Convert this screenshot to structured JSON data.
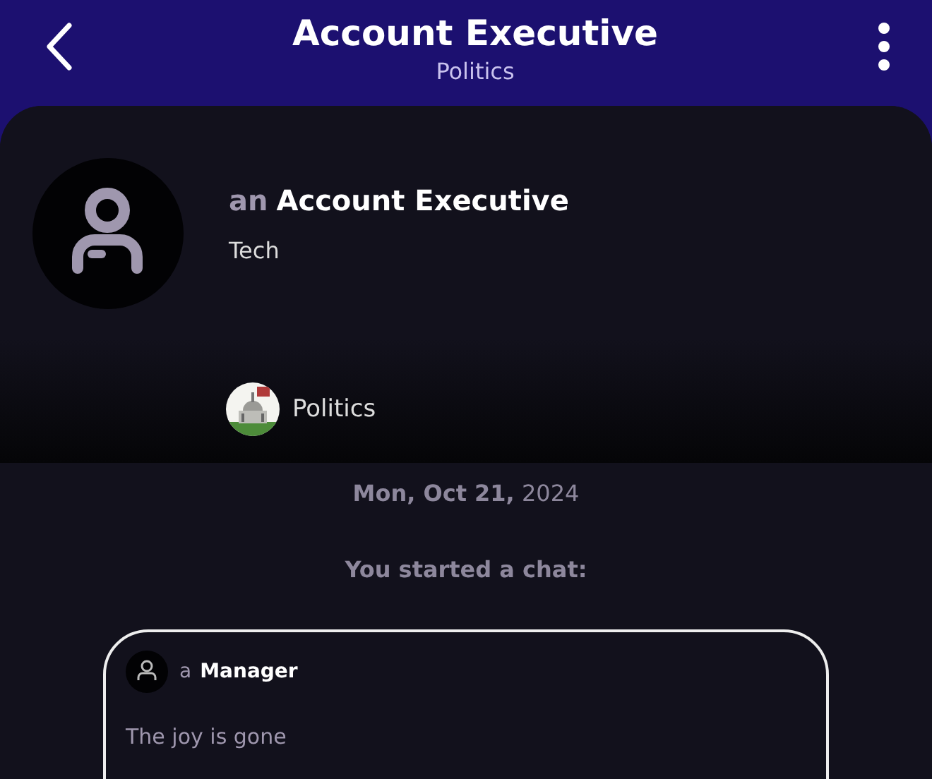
{
  "header": {
    "title": "Account Executive",
    "subtitle": "Politics"
  },
  "profile": {
    "article": "an",
    "name": "Account Executive",
    "industry": "Tech",
    "community": "Politics"
  },
  "date": "**Mon, Oct 21,** 2024",
  "event": "You started a chat:",
  "post": {
    "article": "a",
    "author": "Manager",
    "text": "The joy is gone"
  }
}
